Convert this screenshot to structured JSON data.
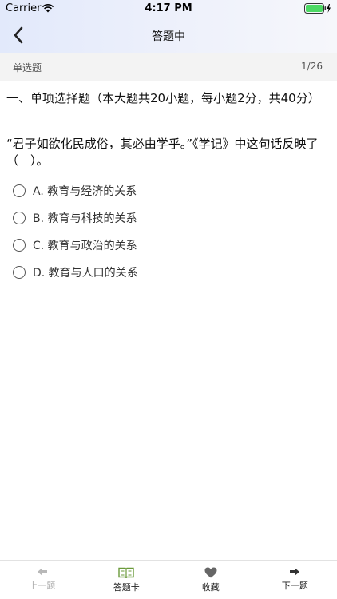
{
  "status": {
    "carrier": "Carrier",
    "time": "4:17 PM"
  },
  "nav": {
    "title": "答题中"
  },
  "question_bar": {
    "type": "单选题",
    "progress": "1/26"
  },
  "section": {
    "text": "一、单项选择题（本大题共20小题，每小题2分，共40分）"
  },
  "question": {
    "stem": "“君子如欲化民成俗，其必由学乎。”《学记》中这句话反映了（　）。",
    "options": [
      {
        "label": "A. 教育与经济的关系"
      },
      {
        "label": "B. 教育与科技的关系"
      },
      {
        "label": "C. 教育与政治的关系"
      },
      {
        "label": "D. 教育与人口的关系"
      }
    ]
  },
  "tabbar": {
    "prev": "上一题",
    "card": "答题卡",
    "favorite": "收藏",
    "next": "下一题",
    "accent_color": "#6a9a3a"
  }
}
